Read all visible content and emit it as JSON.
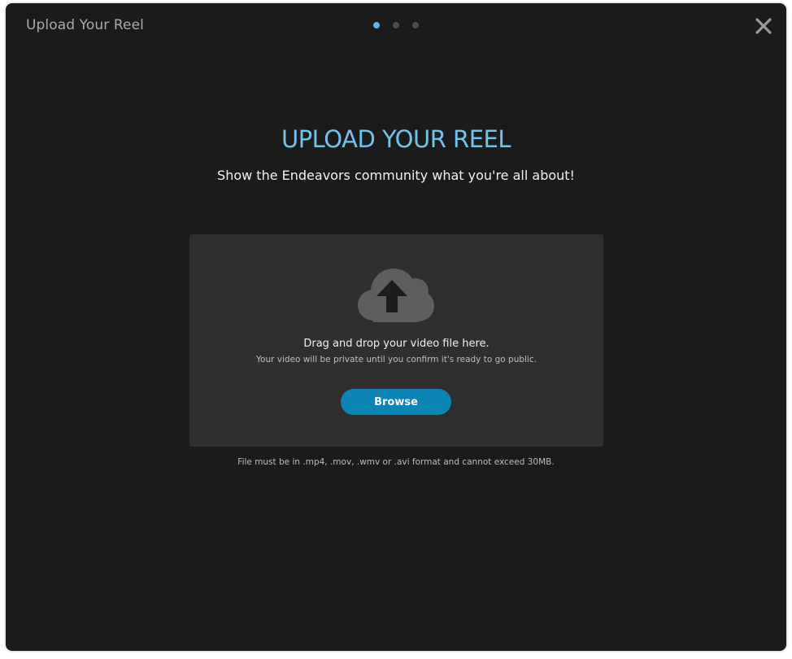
{
  "header": {
    "title": "Upload Your Reel",
    "steps": [
      {
        "state": "active"
      },
      {
        "state": "inactive"
      },
      {
        "state": "inactive"
      }
    ],
    "close_icon": "close-icon"
  },
  "main": {
    "heading": "UPLOAD YOUR REEL",
    "subheading": "Show the Endeavors community what you're all about!"
  },
  "dropzone": {
    "icon": "cloud-upload-icon",
    "instruction": "Drag and drop your video file here.",
    "privacy_note": "Your video will be private until you confirm it's ready to go public.",
    "browse_label": "Browse"
  },
  "footer": {
    "format_note": "File must be in .mp4, .mov, .wmv or .avi format and cannot exceed 30MB."
  },
  "colors": {
    "background": "#1b1b1b",
    "accent": "#72c3ea",
    "button": "#0b86b4",
    "dropzone": "#2f2f2f",
    "active_step": "#5fb6e0"
  }
}
